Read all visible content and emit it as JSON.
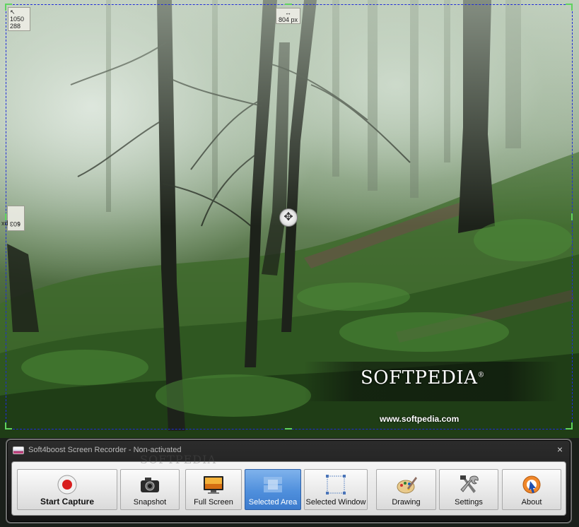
{
  "selection": {
    "origin_readout": [
      "1050",
      "288"
    ],
    "width_readout": "804 px",
    "height_readout": "603 px"
  },
  "watermark": {
    "brand": "SOFTPEDIA",
    "registered": "®",
    "url": "www.softpedia.com"
  },
  "recorder": {
    "title": "Soft4boost Screen Recorder - Non-activated",
    "close_label": "×",
    "button_watermark": "SOFTPEDIA",
    "buttons": [
      {
        "label": "Start Capture",
        "icon": "record-icon"
      },
      {
        "label": "Snapshot",
        "icon": "camera-icon"
      },
      {
        "label": "Full Screen",
        "icon": "monitor-icon"
      },
      {
        "label": "Selected Area",
        "icon": "area-icon"
      },
      {
        "label": "Selected Window",
        "icon": "window-icon"
      },
      {
        "label": "Drawing",
        "icon": "palette-icon"
      },
      {
        "label": "Settings",
        "icon": "tools-icon"
      },
      {
        "label": "About",
        "icon": "about-icon"
      }
    ],
    "active_button": "Selected Area"
  }
}
